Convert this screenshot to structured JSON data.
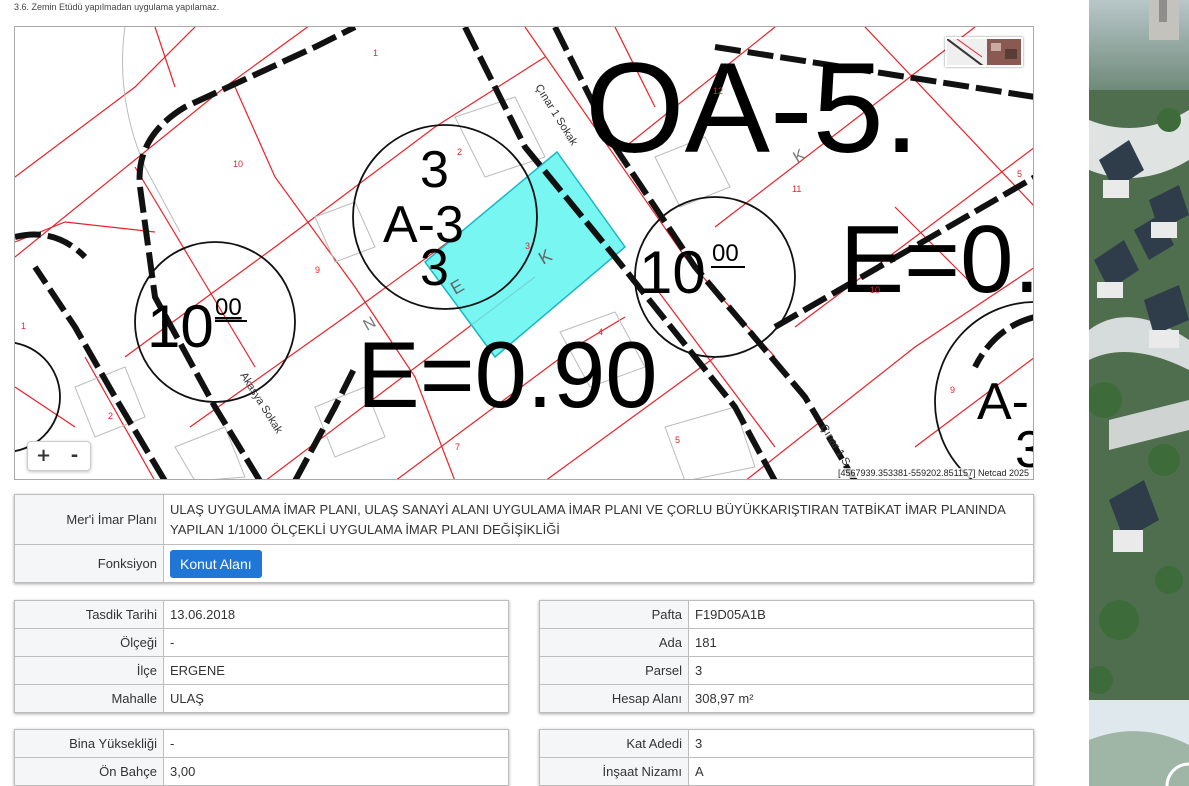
{
  "note": "3.6. Zemin Etüdü yapılmadan uygulama yapılamaz.",
  "map": {
    "zoom_in": "+",
    "zoom_out": "-",
    "coords": "[4567939.353381-559202.851157] Netcad 2025",
    "labels": {
      "zone_big": "OA-5.",
      "e_right": "E=0.",
      "e_main": "E=0.90",
      "hmax_left": "10",
      "hmax_left_sup": "00",
      "hmax_right": "10",
      "hmax_right_sup": "00",
      "circle_a_top": "3",
      "circle_a_mid": "A-3",
      "circle_a_bot": "3",
      "circle_b_mid": "A-",
      "circle_b_bot": "3",
      "street_1": "Çınar 1 Sokak",
      "street_2": "Akasya Sokak",
      "street_3": "Çınar 1 S",
      "letter_e": "E",
      "letter_k": "K",
      "letter_n": "N",
      "letter_k2": "K",
      "p1": "1",
      "p2": "2",
      "p3": "3",
      "p4": "4",
      "p5": "5",
      "p7": "7",
      "p9": "9",
      "p10": "10",
      "p11": "11",
      "p12": "12",
      "p1b": "1",
      "p2b": "2",
      "p5b": "5",
      "p10b": "10",
      "p9b": "9"
    }
  },
  "plan": {
    "label_imar": "Mer'i İmar Planı",
    "value_imar": "ULAŞ UYGULAMA İMAR PLANI, ULAŞ SANAYİ ALANI UYGULAMA İMAR PLANI VE ÇORLU BÜYÜKKARIŞTIRAN TATBİKAT İMAR PLANINDA YAPILAN 1/1000 ÖLÇEKLİ UYGULAMA İMAR PLANI DEĞİŞİKLİĞİ",
    "label_fonksiyon": "Fonksiyon",
    "value_fonksiyon": "Konut Alanı"
  },
  "left_table": [
    {
      "label": "Tasdik Tarihi",
      "value": "13.06.2018"
    },
    {
      "label": "Ölçeği",
      "value": "-"
    },
    {
      "label": "İlçe",
      "value": "ERGENE"
    },
    {
      "label": "Mahalle",
      "value": "ULAŞ"
    }
  ],
  "right_table": [
    {
      "label": "Pafta",
      "value": "F19D05A1B"
    },
    {
      "label": "Ada",
      "value": "181"
    },
    {
      "label": "Parsel",
      "value": "3"
    },
    {
      "label": "Hesap Alanı",
      "value": "308,97 m²"
    }
  ],
  "left_table2": [
    {
      "label": "Bina Yüksekliği",
      "value": "-"
    },
    {
      "label": "Ön Bahçe",
      "value": "3,00"
    }
  ],
  "right_table2": [
    {
      "label": "Kat Adedi",
      "value": "3"
    },
    {
      "label": "İnşaat Nizamı",
      "value": "A"
    }
  ],
  "colors": {
    "parcel_highlight": "#5ff4f0",
    "parcel_line": "#e8222a",
    "road_line": "#111111",
    "button": "#1f76d6"
  }
}
